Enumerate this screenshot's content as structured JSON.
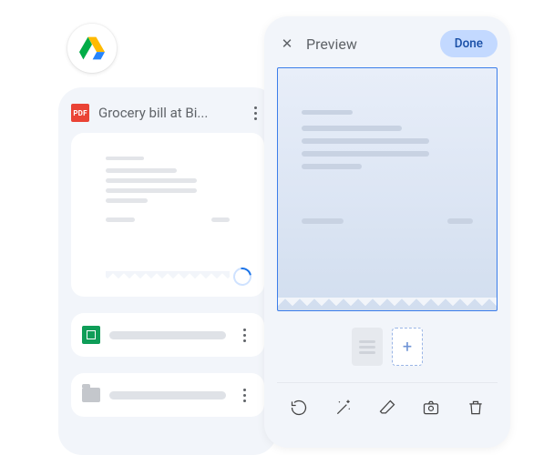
{
  "drive": {
    "file_title": "Grocery bill at Bi...",
    "pdf_label": "PDF"
  },
  "preview": {
    "title": "Preview",
    "done_label": "Done",
    "add_page_symbol": "+"
  },
  "icons": {
    "close": "✕"
  }
}
